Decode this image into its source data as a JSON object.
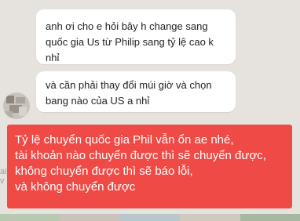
{
  "messages": [
    {
      "lines": [
        "anh ơi cho e hỏi bây h change sang",
        "quốc gia Us từ Philip sang tỷ lệ cao k",
        "nhỉ"
      ]
    },
    {
      "lines": [
        "và cần phải thay đổi múi giờ và chọn",
        "bang nào của US a nhỉ"
      ]
    }
  ],
  "reply_note": {
    "lines": [
      "Tỷ lệ chuyển quốc gia Phil vẫn ổn ae nhé,",
      "tài khoản nào chuyển được thì sẽ chuyển được,",
      "không chuyển được thì sẽ báo lỗi,",
      "và không chuyển được"
    ],
    "color": "#ef4a45"
  },
  "side_text": "ai\nv",
  "colors": {
    "chat_background": "#e6e3de",
    "bubble": "#ffffff",
    "strip": [
      "#b9c8b0",
      "#c9c3bb",
      "#b8c7cc",
      "#d0c9bf",
      "#a7b7a2"
    ]
  }
}
